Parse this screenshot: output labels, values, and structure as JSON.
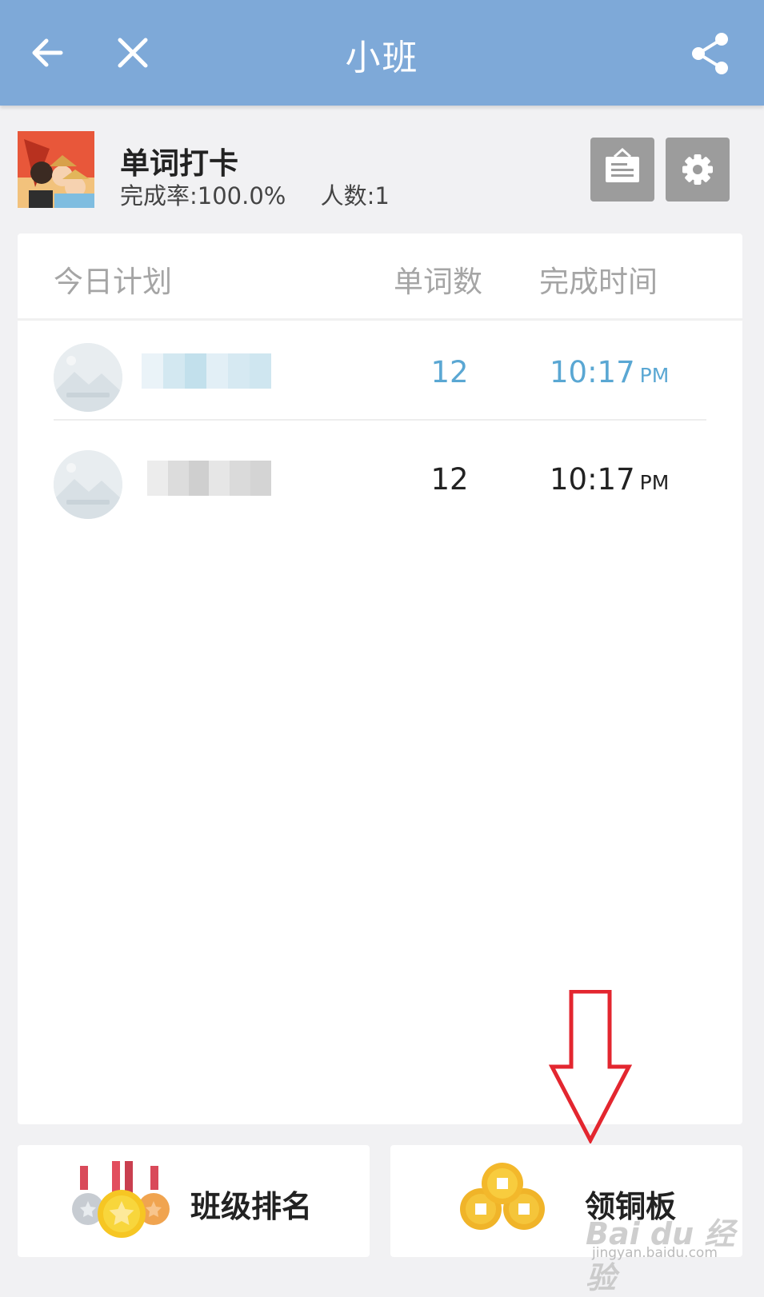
{
  "header": {
    "title": "小班",
    "back_icon": "arrow-left-icon",
    "close_icon": "close-icon",
    "share_icon": "share-icon",
    "bg_color": "#7ea9d8"
  },
  "class_info": {
    "name": "单词打卡",
    "completion_rate": "完成率:100.0%",
    "member_count": "人数:1",
    "notice_icon": "notice-board-icon",
    "settings_icon": "gear-icon"
  },
  "plan_table": {
    "columns": [
      "今日计划",
      "单词数",
      "完成时间"
    ],
    "rows": [
      {
        "name_blurred": true,
        "word_count": "12",
        "time": "10:17",
        "ampm": "PM",
        "color": "#5aa7d3"
      },
      {
        "name_blurred": true,
        "word_count": "12",
        "time": "10:17",
        "ampm": "PM",
        "color": "#222222"
      }
    ]
  },
  "bottom_buttons": {
    "ranking_label": "班级排名",
    "ranking_icon": "medals-icon",
    "coins_label": "领铜板",
    "coins_icon": "copper-coins-icon"
  },
  "annotation": {
    "arrow_icon": "red-down-arrow-icon",
    "watermark": "Bai du 经验",
    "watermark_sub": "jingyan.baidu.com"
  }
}
